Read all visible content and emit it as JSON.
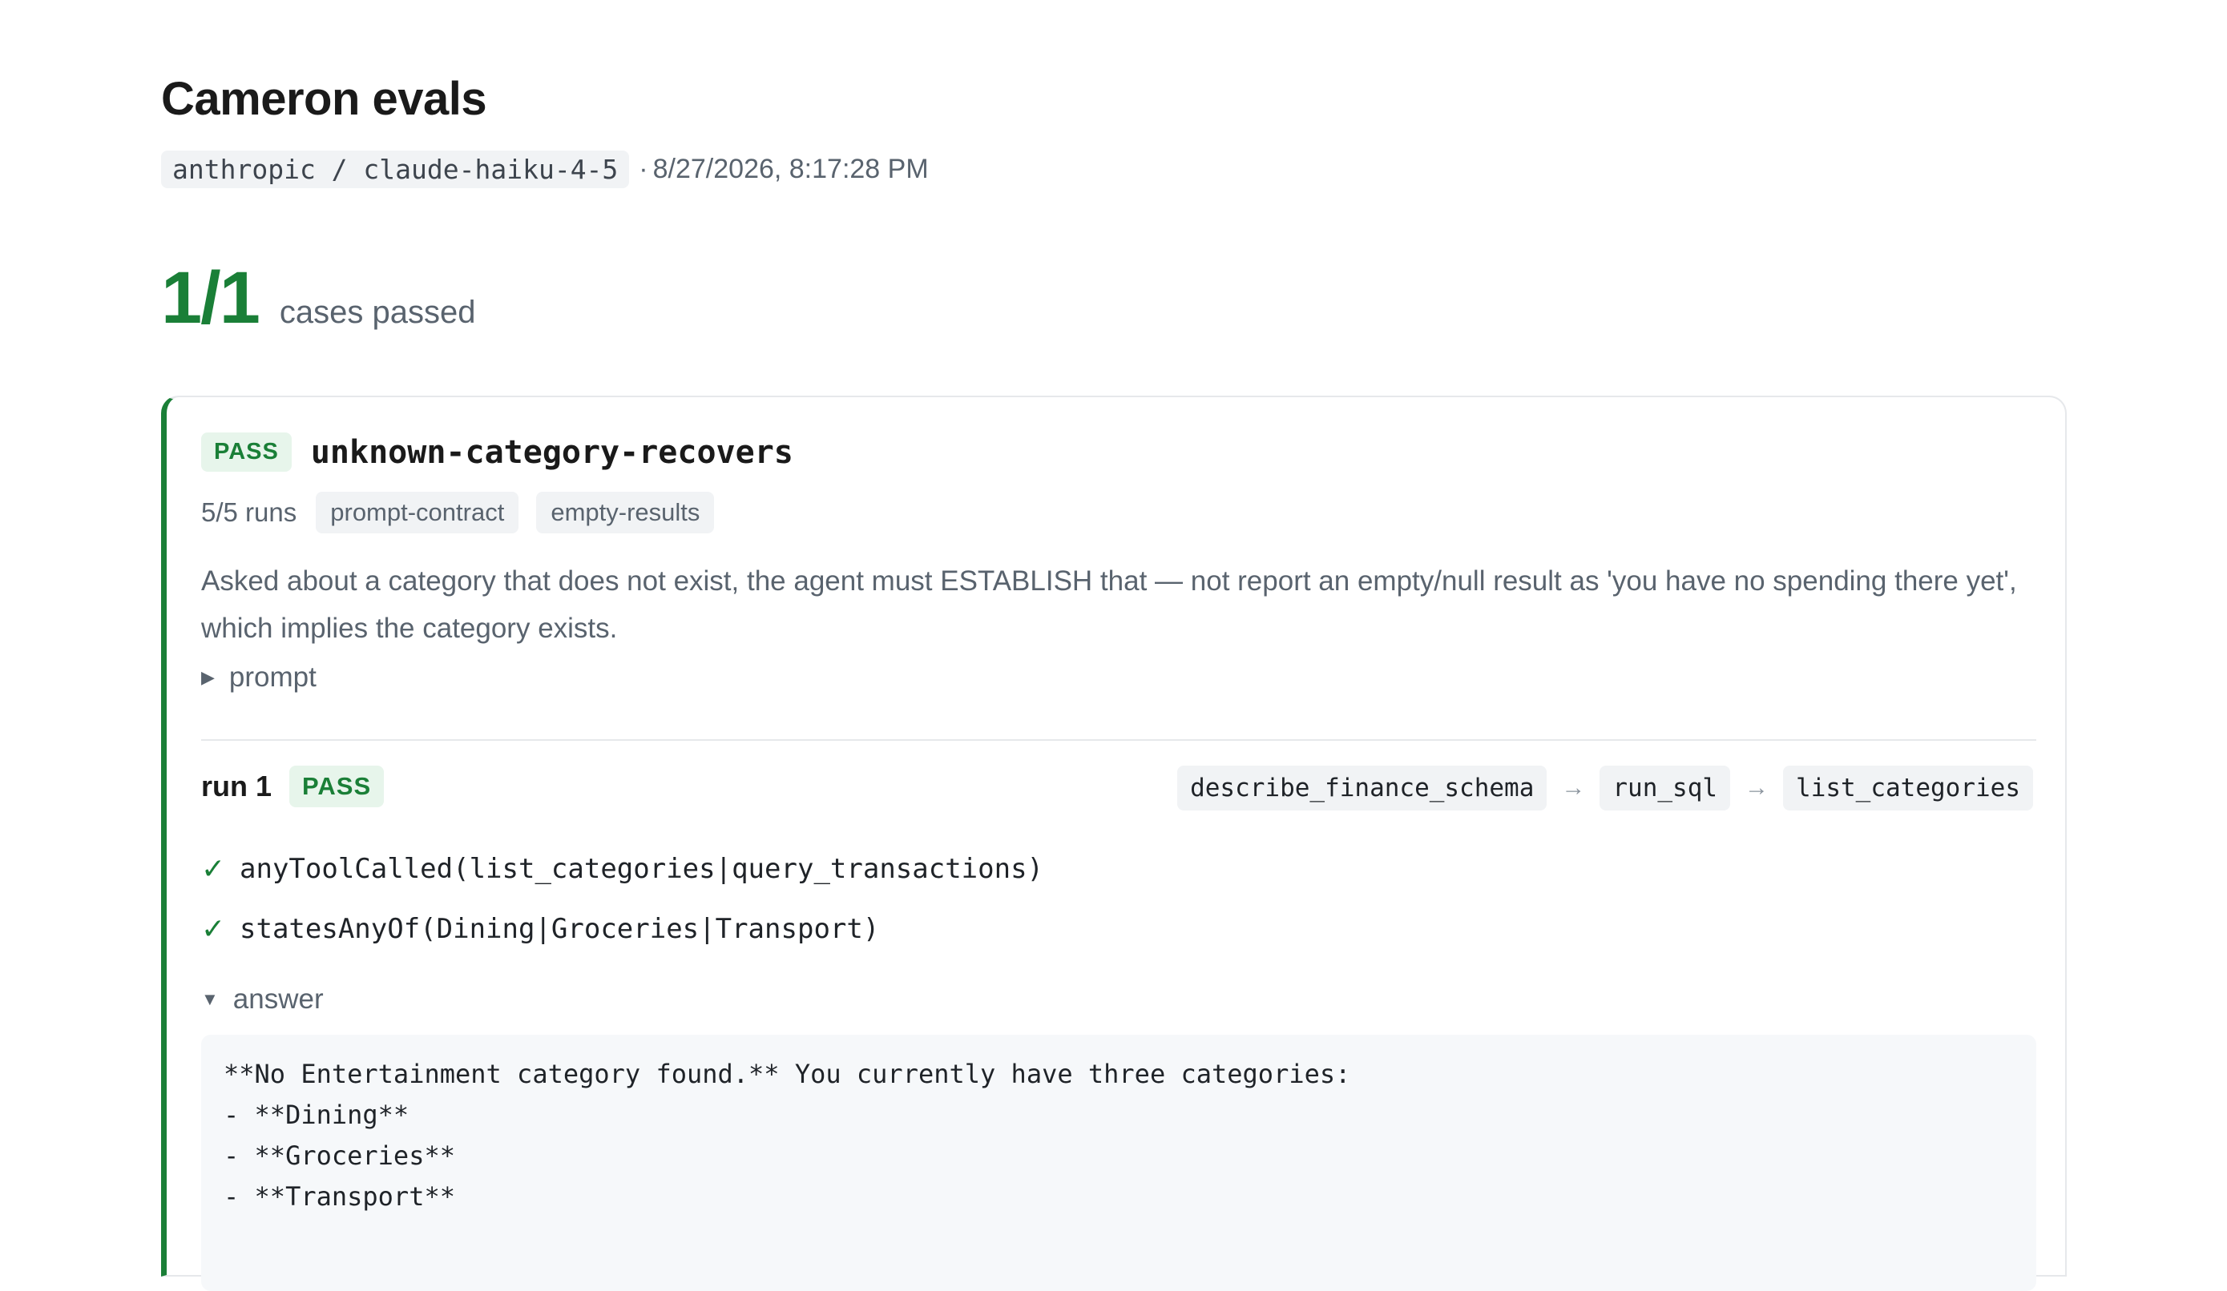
{
  "header": {
    "title": "Cameron evals",
    "provider_model": "anthropic / claude-haiku-4-5",
    "timestamp": "8/27/2026, 8:17:28 PM",
    "separator": "·"
  },
  "summary": {
    "score": "1/1",
    "label": "cases passed"
  },
  "case": {
    "status": "PASS",
    "name": "unknown-category-recovers",
    "runs": "5/5 runs",
    "tags": [
      "prompt-contract",
      "empty-results"
    ],
    "description": "Asked about a category that does not exist, the agent must ESTABLISH that — not report an empty/null result as 'you have no spending there yet', which implies the category exists.",
    "prompt_toggle": {
      "icon": "▶",
      "label": "prompt"
    }
  },
  "run": {
    "title": "run 1",
    "status": "PASS",
    "tool_chain": [
      "describe_finance_schema",
      "run_sql",
      "list_categories"
    ],
    "chain_arrow": "→",
    "checks": [
      {
        "icon": "✓",
        "expr": "anyToolCalled(list_categories|query_transactions)"
      },
      {
        "icon": "✓",
        "expr": "statesAnyOf(Dining|Groceries|Transport)"
      }
    ],
    "answer_toggle": {
      "icon": "▼",
      "label": "answer"
    },
    "answer_lines": [
      "**No Entertainment category found.** You currently have three categories:",
      "- **Dining**",
      "- **Groceries**",
      "- **Transport**"
    ]
  },
  "colors": {
    "accent_pass": "#1a7f37",
    "badge_bg": "#e7f5eb"
  }
}
